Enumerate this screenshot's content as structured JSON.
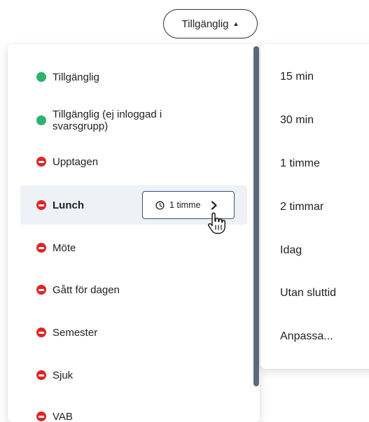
{
  "status_button": {
    "label": "Tillgänglig",
    "caret": "▲"
  },
  "status_menu": {
    "items": [
      {
        "label": "Tillgänglig",
        "icon": "green-dot-icon"
      },
      {
        "label": "Tillgänglig (ej inloggad i svarsgrupp)",
        "icon": "green-dot-icon"
      },
      {
        "label": "Upptagen",
        "icon": "red-minus-icon"
      },
      {
        "label": "Lunch",
        "icon": "red-minus-icon"
      },
      {
        "label": "Möte",
        "icon": "red-minus-icon"
      },
      {
        "label": "Gått för dagen",
        "icon": "red-minus-icon"
      },
      {
        "label": "Semester",
        "icon": "red-minus-icon"
      },
      {
        "label": "Sjuk",
        "icon": "red-minus-icon"
      },
      {
        "label": "VAB",
        "icon": "red-minus-icon"
      }
    ],
    "selected_duration": "1 timme"
  },
  "duration_menu": {
    "items": [
      "15 min",
      "30 min",
      "1 timme",
      "2 timmar",
      "Idag",
      "Utan sluttid",
      "Anpassa..."
    ]
  },
  "colors": {
    "available": "#2fb36b",
    "busy": "#e02424",
    "selected_bg": "#eef1f6"
  }
}
